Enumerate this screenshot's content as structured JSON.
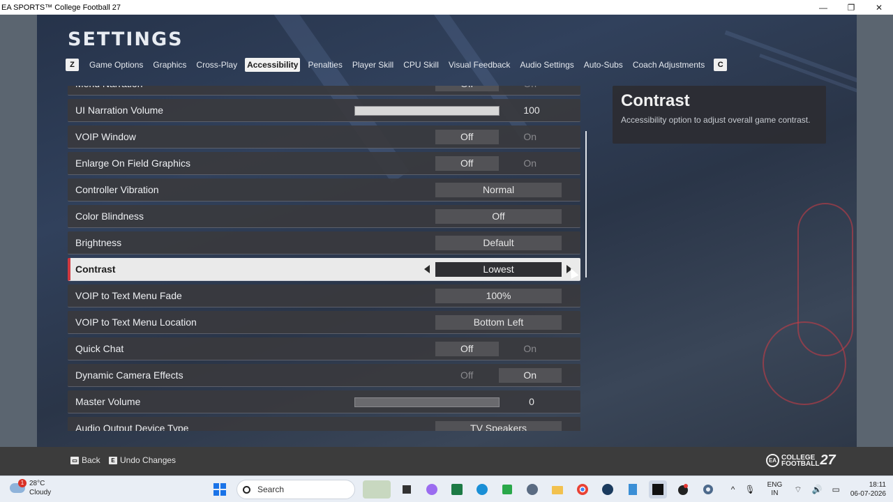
{
  "window": {
    "title": "EA SPORTS™ College Football 27",
    "minimize": "—",
    "maximize": "❐",
    "close": "✕"
  },
  "screen": {
    "title": "SETTINGS",
    "tab_key_left": "Z",
    "tab_key_right": "C",
    "tabs": [
      {
        "label": "Game Options"
      },
      {
        "label": "Graphics"
      },
      {
        "label": "Cross-Play"
      },
      {
        "label": "Accessibility"
      },
      {
        "label": "Penalties"
      },
      {
        "label": "Player Skill"
      },
      {
        "label": "CPU Skill"
      },
      {
        "label": "Visual Feedback"
      },
      {
        "label": "Audio Settings"
      },
      {
        "label": "Auto-Subs"
      },
      {
        "label": "Coach Adjustments"
      }
    ],
    "active_tab": "Accessibility"
  },
  "settings": [
    {
      "label": "Menu Narration",
      "type": "toggle",
      "off": "Off",
      "on": "On",
      "selected": "Off"
    },
    {
      "label": "UI Narration Volume",
      "type": "slider",
      "value": "100",
      "fraction": 1.0
    },
    {
      "label": "VOIP Window",
      "type": "toggle",
      "off": "Off",
      "on": "On",
      "selected": "Off"
    },
    {
      "label": "Enlarge On Field Graphics",
      "type": "toggle",
      "off": "Off",
      "on": "On",
      "selected": "Off"
    },
    {
      "label": "Controller Vibration",
      "type": "select",
      "value": "Normal"
    },
    {
      "label": "Color Blindness",
      "type": "select",
      "value": "Off"
    },
    {
      "label": "Brightness",
      "type": "select",
      "value": "Default"
    },
    {
      "label": "Contrast",
      "type": "select",
      "value": "Lowest",
      "selected_row": true
    },
    {
      "label": "VOIP to Text Menu Fade",
      "type": "select",
      "value": "100%"
    },
    {
      "label": "VOIP to Text Menu Location",
      "type": "select",
      "value": "Bottom Left"
    },
    {
      "label": "Quick Chat",
      "type": "toggle",
      "off": "Off",
      "on": "On",
      "selected": "Off"
    },
    {
      "label": "Dynamic Camera Effects",
      "type": "toggle",
      "off": "Off",
      "on": "On",
      "selected": "On"
    },
    {
      "label": "Master Volume",
      "type": "slider",
      "value": "0",
      "fraction": 0.0
    },
    {
      "label": "Audio Output Device Type",
      "type": "select",
      "value": "TV Speakers"
    }
  ],
  "description": {
    "title": "Contrast",
    "text": "Accessibility option to adjust overall game contrast."
  },
  "footer": {
    "back_key": "▭",
    "back_label": "Back",
    "undo_key": "E",
    "undo_label": "Undo Changes",
    "logo_ea": "EA",
    "logo_line1": "COLLEGE",
    "logo_line2": "FOOTBALL",
    "logo_num": "27"
  },
  "taskbar": {
    "weather_temp": "28°C",
    "weather_desc": "Cloudy",
    "weather_badge": "1",
    "search_placeholder": "Search",
    "lang_line1": "ENG",
    "lang_line2": "IN",
    "time": "18:11",
    "date": "06-07-2026"
  }
}
